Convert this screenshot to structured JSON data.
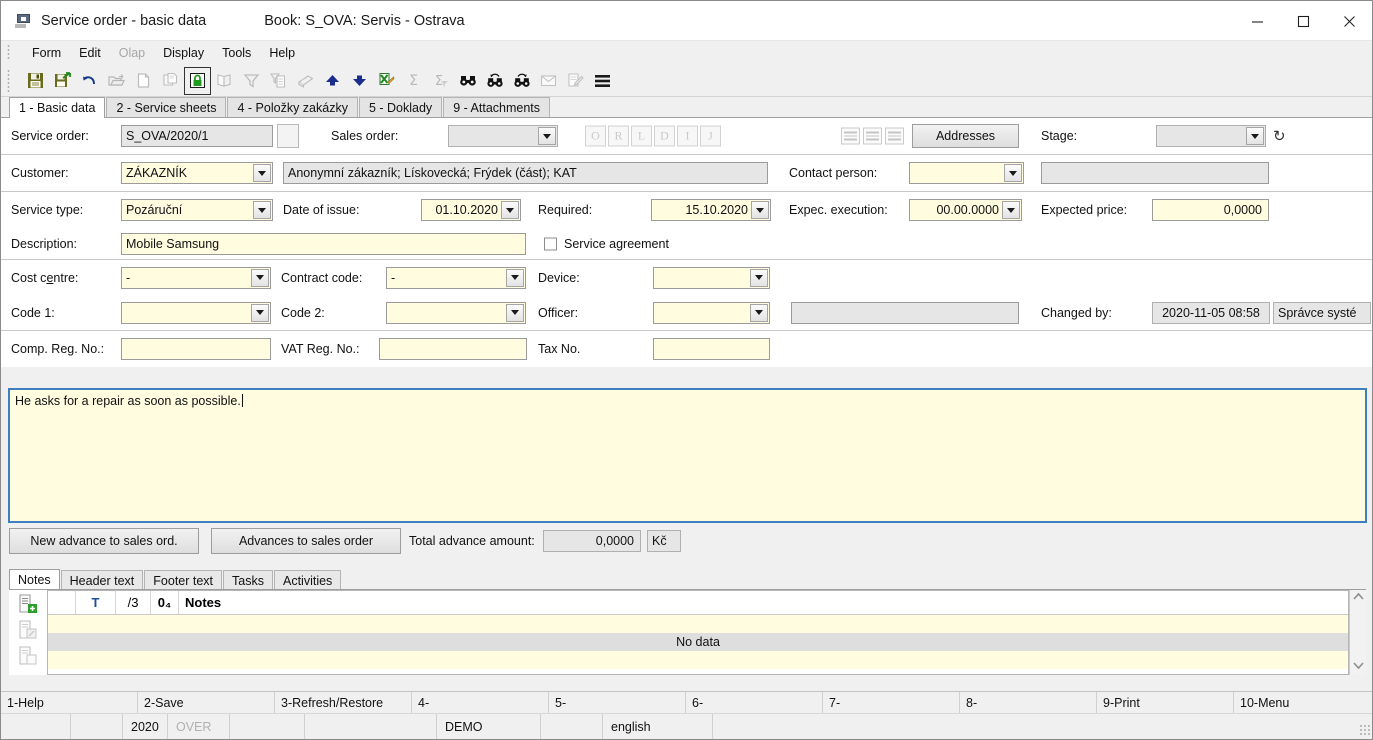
{
  "window": {
    "icon": "app-icon",
    "title": "Service order - basic data",
    "book": "Book: S_OVA: Servis - Ostrava",
    "minimize": "—",
    "maximize": "☐",
    "close": "✕"
  },
  "menu": [
    {
      "label": "Form",
      "disabled": false
    },
    {
      "label": "Edit",
      "disabled": false
    },
    {
      "label": "Olap",
      "disabled": true
    },
    {
      "label": "Display",
      "disabled": false
    },
    {
      "label": "Tools",
      "disabled": false
    },
    {
      "label": "Help",
      "disabled": false
    }
  ],
  "toolbar": [
    {
      "name": "save-icon",
      "disabled": false
    },
    {
      "name": "save-and-exit-icon",
      "disabled": false
    },
    {
      "name": "undo-icon",
      "disabled": false
    },
    {
      "name": "open-folder-icon",
      "disabled": true
    },
    {
      "name": "new-document-icon",
      "disabled": true
    },
    {
      "name": "copy-icon",
      "disabled": true
    },
    {
      "name": "lock-icon",
      "disabled": false
    },
    {
      "name": "book-icon",
      "disabled": true
    },
    {
      "name": "filter-icon",
      "disabled": true
    },
    {
      "name": "filter-document-icon",
      "disabled": true
    },
    {
      "name": "print-icon",
      "disabled": true
    },
    {
      "name": "arrow-up-icon",
      "disabled": false
    },
    {
      "name": "arrow-down-icon",
      "disabled": false
    },
    {
      "name": "export-excel-icon",
      "disabled": false
    },
    {
      "name": "sum-icon",
      "disabled": true
    },
    {
      "name": "sum-filter-icon",
      "disabled": true
    },
    {
      "name": "find-icon",
      "disabled": false
    },
    {
      "name": "find-previous-icon",
      "disabled": false
    },
    {
      "name": "find-next-icon",
      "disabled": false
    },
    {
      "name": "mail-icon",
      "disabled": true
    },
    {
      "name": "notes-icon",
      "disabled": true
    },
    {
      "name": "menu-icon",
      "disabled": false
    }
  ],
  "tabs": [
    {
      "label": "1 - Basic data",
      "active": true
    },
    {
      "label": "2 - Service sheets",
      "active": false
    },
    {
      "label": "4 - Položky zakázky",
      "active": false
    },
    {
      "label": "5 - Doklady",
      "active": false
    },
    {
      "label": "9 - Attachments",
      "active": false
    }
  ],
  "form": {
    "service_order_label": "Service order:",
    "service_order_value": "S_OVA/2020/1",
    "sales_order_label": "Sales order:",
    "sales_order_value": "",
    "flags": [
      "O",
      "R",
      "L",
      "D",
      "I",
      "J"
    ],
    "addresses_button": "Addresses",
    "stage_label": "Stage:",
    "stage_value": "",
    "history_icon": "history-icon",
    "customer_label": "Customer:",
    "customer_value": "ZÁKAZNÍK",
    "customer_detail": "Anonymní zákazník; Lískovecká; Frýdek (část); KAT",
    "contact_person_label": "Contact person:",
    "contact_person_value": "",
    "contact_person_detail": "",
    "service_type_label": "Service type:",
    "service_type_value": "Pozáruční",
    "date_of_issue_label": "Date of issue:",
    "date_of_issue_value": "01.10.2020",
    "required_label": "Required:",
    "required_value": "15.10.2020",
    "expec_execution_label": "Expec. execution:",
    "expec_execution_value": "00.00.0000",
    "expected_price_label": "Expected price:",
    "expected_price_value": "0,0000",
    "description_label": "Description:",
    "description_value": "Mobile Samsung",
    "service_agreement_label": "Service agreement",
    "service_agreement_checked": false,
    "cost_centre_label": "Cost c",
    "cost_centre_label_u": "e",
    "cost_centre_label_end": "ntre:",
    "cost_centre_value": "-",
    "contract_code_label": "Contract code:",
    "contract_code_value": "-",
    "device_label": "Device:",
    "device_value": "",
    "code1_label": "Code 1:",
    "code1_value": "",
    "code2_label": "Code 2:",
    "code2_value": "",
    "officer_label": "Officer:",
    "officer_value": "",
    "officer_detail": "",
    "changed_by_label": "Changed by:",
    "changed_by_date": "2020-11-05 08:58",
    "changed_by_user": "Správce systé",
    "comp_reg_no_label": "Comp. Reg. No.:",
    "comp_reg_no_value": "",
    "vat_reg_no_label": "VAT Reg. No.:",
    "vat_reg_no_value": "",
    "tax_no_label": "Tax No.",
    "tax_no_value": ""
  },
  "memo": {
    "text": "He asks for a repair as soon as possible."
  },
  "advance": {
    "new_advance_button": "New advance to sales ord.",
    "advances_button": "Advances to sales order",
    "total_label": "Total advance amount:",
    "total_value": "0,0000",
    "currency": "Kč"
  },
  "bottom_tabs": [
    {
      "label": "Notes",
      "active": true
    },
    {
      "label": "Header text",
      "active": false
    },
    {
      "label": "Footer text",
      "active": false
    },
    {
      "label": "Tasks",
      "active": false
    },
    {
      "label": "Activities",
      "active": false
    }
  ],
  "notes_grid": {
    "side_icons": [
      "new-note-icon",
      "edit-note-icon",
      "copy-note-icon"
    ],
    "columns": [
      "T",
      "/3",
      "0₄",
      "Notes"
    ],
    "no_data": "No data",
    "scroll_up": "⌃",
    "scroll_down": "⌄"
  },
  "fkeys": [
    "1-Help",
    "2-Save",
    "3-Refresh/Restore",
    "4-",
    "5-",
    "6-",
    "7-",
    "8-",
    "9-Print",
    "10-Menu"
  ],
  "statusbar": {
    "cell1": "",
    "cell2": "",
    "year": "2020",
    "over": "OVER",
    "cell5": "",
    "cell6": "",
    "demo": "DEMO",
    "cell8": "",
    "language": "english",
    "cell10": ""
  },
  "colors": {
    "field_bg": "#fffce0",
    "readonly_bg": "#e6e6e6",
    "focus_border": "#3f7fbf",
    "nodata_row": "#dedede"
  }
}
